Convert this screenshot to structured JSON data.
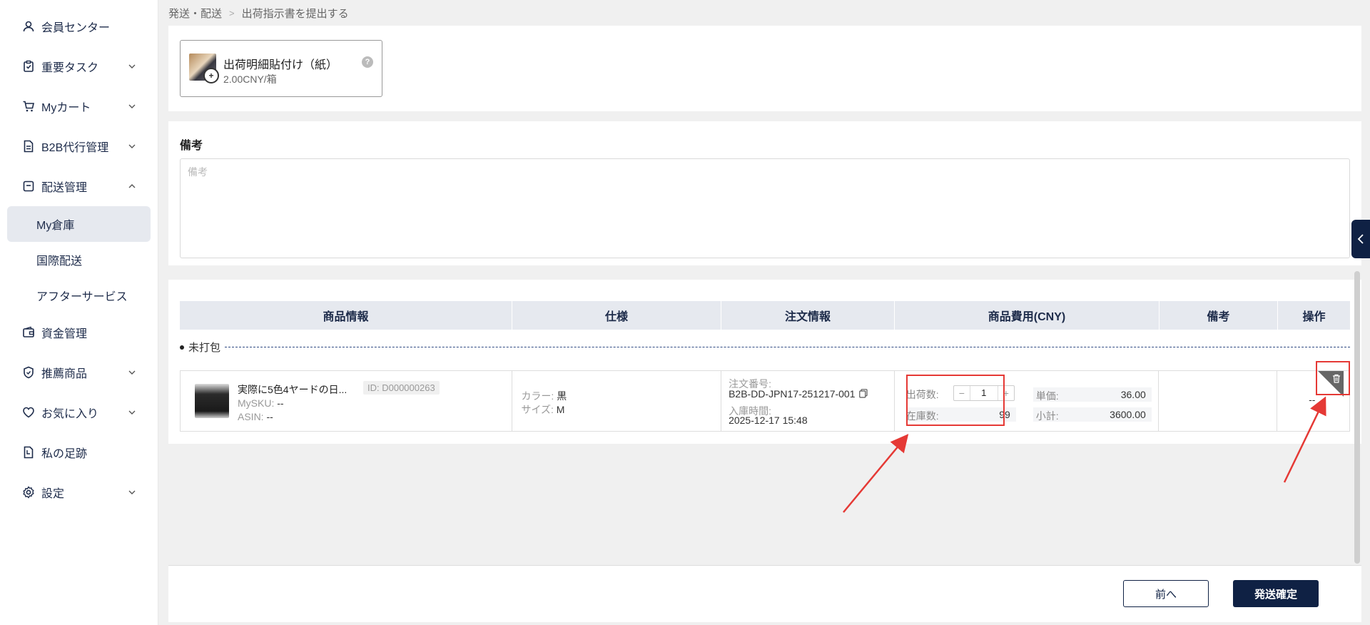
{
  "sidebar": {
    "items": [
      {
        "label": "会員センター",
        "icon": "user-icon",
        "chevron": ""
      },
      {
        "label": "重要タスク",
        "icon": "clipboard-check-icon",
        "chevron": "down"
      },
      {
        "label": "Myカート",
        "icon": "cart-icon",
        "chevron": "down"
      },
      {
        "label": "B2B代行管理",
        "icon": "document-icon",
        "chevron": "down"
      },
      {
        "label": "配送管理",
        "icon": "box-icon",
        "chevron": "up"
      }
    ],
    "sub_items": [
      {
        "label": "My倉庫",
        "active": true
      },
      {
        "label": "国際配送",
        "active": false
      },
      {
        "label": "アフターサービス",
        "active": false
      }
    ],
    "items_lower": [
      {
        "label": "資金管理",
        "icon": "wallet-icon",
        "chevron": ""
      },
      {
        "label": "推薦商品",
        "icon": "badge-icon",
        "chevron": "down"
      },
      {
        "label": "お気に入り",
        "icon": "heart-icon",
        "chevron": "down"
      },
      {
        "label": "私の足跡",
        "icon": "footprint-icon",
        "chevron": ""
      },
      {
        "label": "設定",
        "icon": "gear-icon",
        "chevron": "down"
      }
    ]
  },
  "breadcrumb": {
    "parent": "発送・配送",
    "separator": ">",
    "current": "出荷指示書を提出する"
  },
  "service": {
    "title": "出荷明細貼付け（紙）",
    "price": "2.00CNY/箱",
    "help": "?"
  },
  "note": {
    "title": "備考",
    "placeholder": "備考",
    "value": ""
  },
  "table": {
    "headers": [
      "商品情報",
      "仕様",
      "注文情報",
      "商品費用(CNY)",
      "備考",
      "操作"
    ],
    "group_label": "未打包",
    "rows": [
      {
        "name": "実際に5色4ヤードの日...",
        "id": "ID: D000000263",
        "mysku_label": "MySKU: ",
        "mysku": "--",
        "asin_label": "ASIN: ",
        "asin": "--",
        "color_label": "カラー: ",
        "color": "黒",
        "size_label": "サイズ: ",
        "size": "M",
        "order_no_label": "注文番号:",
        "order_no": "B2B-DD-JPN17-251217-001",
        "inbound_label": "入庫時間:",
        "inbound": "2025-12-17 15:48",
        "ship_qty_label": "出荷数:",
        "ship_qty": "1",
        "minus": "−",
        "plus": "+",
        "stock_label": "在庫数:",
        "stock": "99",
        "unit_price_label": "単価:",
        "unit_price": "36.00",
        "subtotal_label": "小計:",
        "subtotal": "3600.00",
        "remark": "",
        "ops": "--"
      }
    ]
  },
  "footer": {
    "prev_label": "前へ",
    "confirm_label": "発送確定"
  },
  "colors": {
    "primary": "#0f2144",
    "header_bg": "#e6e9ef",
    "highlight": "#e53935"
  }
}
